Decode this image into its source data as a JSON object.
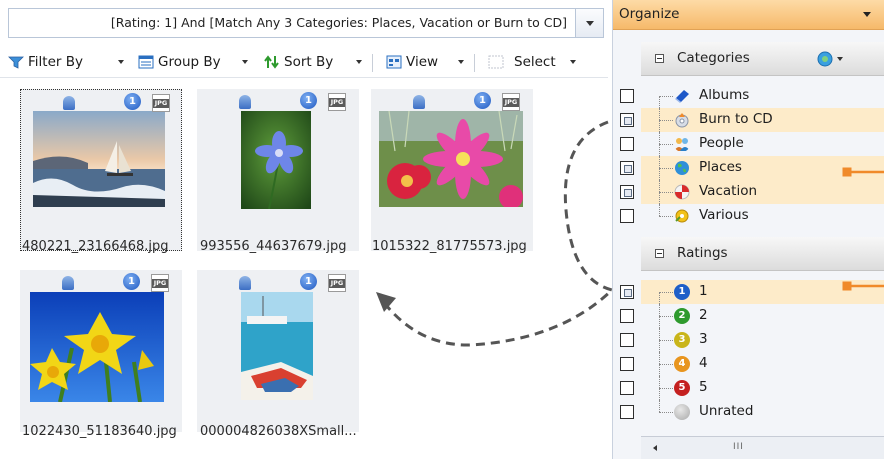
{
  "query": {
    "text": "[Rating: 1] And [Match Any 3 Categories: Places, Vacation or Burn to CD]"
  },
  "toolbar": {
    "filter_label": "Filter By",
    "group_label": "Group By",
    "sort_label": "Sort By",
    "view_label": "View",
    "select_label": "Select"
  },
  "thumbnails": [
    {
      "caption": "480221_23166468.jpg",
      "rating": "1",
      "badge": "JPG"
    },
    {
      "caption": "993556_44637679.jpg",
      "rating": "1",
      "badge": "JPG"
    },
    {
      "caption": "1015322_81775573.jpg",
      "rating": "1",
      "badge": "JPG"
    },
    {
      "caption": "1022430_51183640.jpg",
      "rating": "1",
      "badge": "JPG"
    },
    {
      "caption": "000004826038XSmall...",
      "rating": "1",
      "badge": "JPG"
    }
  ],
  "organize": {
    "title": "Organize",
    "categories_title": "Categories",
    "categories": [
      {
        "label": "Albums",
        "icon": "album-icon",
        "state": "unchecked"
      },
      {
        "label": "Burn to CD",
        "icon": "cd-icon",
        "state": "mixed"
      },
      {
        "label": "People",
        "icon": "people-icon",
        "state": "unchecked"
      },
      {
        "label": "Places",
        "icon": "globe-icon",
        "state": "mixed"
      },
      {
        "label": "Vacation",
        "icon": "vacation-icon",
        "state": "mixed"
      },
      {
        "label": "Various",
        "icon": "various-icon",
        "state": "unchecked"
      }
    ],
    "ratings_title": "Ratings",
    "ratings": [
      {
        "label": "1",
        "badge": "1",
        "color": "#1f5fc8",
        "state": "mixed"
      },
      {
        "label": "2",
        "badge": "2",
        "color": "#2e9a2e",
        "state": "unchecked"
      },
      {
        "label": "3",
        "badge": "3",
        "color": "#c9b51a",
        "state": "unchecked"
      },
      {
        "label": "4",
        "badge": "4",
        "color": "#e8951f",
        "state": "unchecked"
      },
      {
        "label": "5",
        "badge": "5",
        "color": "#c42020",
        "state": "unchecked"
      },
      {
        "label": "Unrated",
        "badge": "",
        "color": "#bdbdbd",
        "state": "unchecked"
      }
    ],
    "scroll_grip": "III"
  },
  "colors": {
    "highlight_row": "#fdebc9",
    "header_orange": "#f6b96a",
    "arrow_orange": "#f08a2a"
  }
}
